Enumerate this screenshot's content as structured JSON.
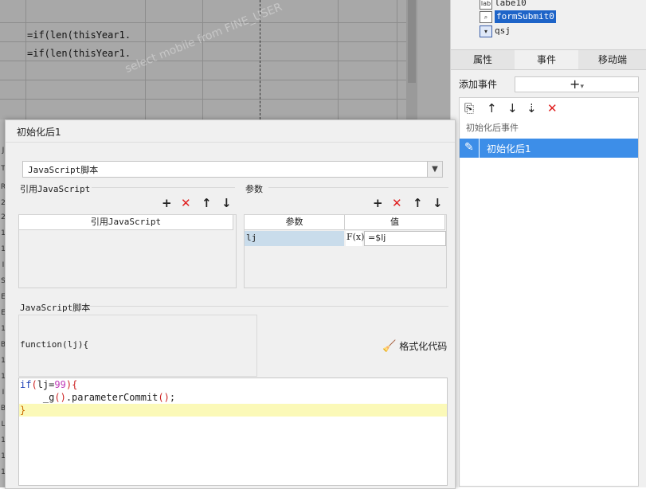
{
  "sheet": {
    "formulas": [
      "=if(len(thisYear1.",
      "=if(len(thisYear1."
    ],
    "watermark": "select mobile from FINE_USER"
  },
  "row_gutter": [
    "J",
    "T",
    "R",
    "2",
    "2",
    "1",
    "1",
    "I",
    "S",
    "E",
    "E",
    "1",
    "B",
    "1",
    "1",
    "I",
    "B",
    "L",
    "1",
    "1",
    "1"
  ],
  "right_panel": {
    "tree": [
      {
        "label": "labe10",
        "icon": "label-icon",
        "selected": false
      },
      {
        "label": "formSubmit0",
        "icon": "form-submit-icon",
        "selected": true
      },
      {
        "label": "qsj",
        "icon": "dropdown-icon",
        "selected": false
      }
    ],
    "tabs": [
      "属性",
      "事件",
      "移动端"
    ],
    "active_tab": "事件",
    "add_event_label": "添加事件",
    "add_button": "+",
    "event_header": "初始化后事件",
    "event_item": "初始化后1",
    "accent_color": "#3d8ee8"
  },
  "dialog": {
    "title": "初始化后1",
    "type_select": "JavaScript脚本",
    "ref_js": {
      "title": "引用JavaScript",
      "column": "引用JavaScript"
    },
    "params": {
      "title": "参数",
      "columns": [
        "参数",
        "值"
      ],
      "rows": [
        {
          "name": "lj",
          "formula_btn": "F(x)",
          "value": "=$lj"
        }
      ]
    },
    "script": {
      "title": "JavaScript脚本",
      "function_sig": "function(lj){",
      "format_button": "格式化代码"
    },
    "code": {
      "line1_kw": "if",
      "line1_open": "(",
      "line1_var": "lj",
      "line1_eq": "=",
      "line1_num": "99",
      "line1_close": ")",
      "line1_brace": "{",
      "line2_pre": "    _g",
      "line2_p1": "()",
      "line2_mid": ".parameterCommit",
      "line2_p2": "()",
      "line2_end": ";",
      "line3": "}"
    }
  }
}
